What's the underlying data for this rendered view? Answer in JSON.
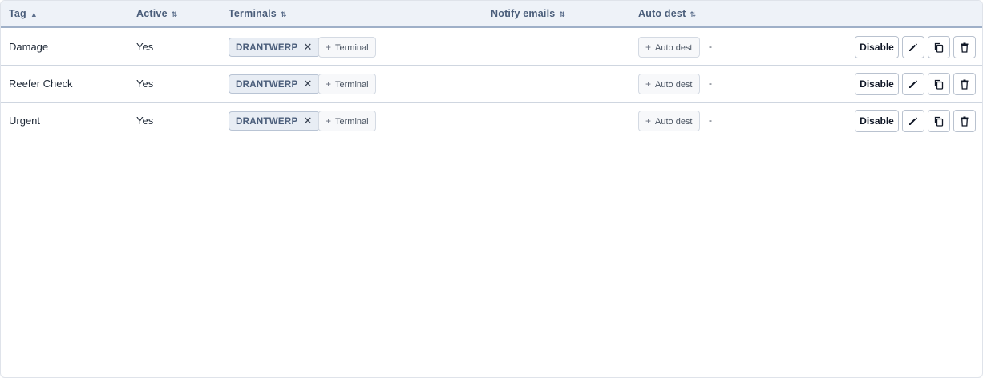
{
  "table": {
    "columns": [
      {
        "label": "Tag",
        "sort": "▲"
      },
      {
        "label": "Active",
        "sort": "⇅"
      },
      {
        "label": "Terminals",
        "sort": "⇅"
      },
      {
        "label": "Notify emails",
        "sort": "⇅"
      },
      {
        "label": "Auto dest",
        "sort": "⇅"
      }
    ],
    "rows": [
      {
        "tag": "Damage",
        "active": "Yes",
        "terminal_chip": "DRANTWERP",
        "add_terminal": "Terminal",
        "add_autodest": "Auto dest",
        "autodest_value": "-",
        "disable_label": "Disable"
      },
      {
        "tag": "Reefer Check",
        "active": "Yes",
        "terminal_chip": "DRANTWERP",
        "add_terminal": "Terminal",
        "add_autodest": "Auto dest",
        "autodest_value": "-",
        "disable_label": "Disable"
      },
      {
        "tag": "Urgent",
        "active": "Yes",
        "terminal_chip": "DRANTWERP",
        "add_terminal": "Terminal",
        "add_autodest": "Auto dest",
        "autodest_value": "-",
        "disable_label": "Disable"
      }
    ]
  },
  "icons": {
    "sort_asc": "sort-ascending-icon",
    "sort_both": "sort-icon",
    "chip_remove": "close-icon",
    "add": "plus-icon",
    "edit": "pencil-icon",
    "duplicate": "copy-icon",
    "delete": "trash-icon"
  },
  "colors": {
    "header_bg": "#eef2f8",
    "header_text": "#4a5d7a",
    "chip_bg": "#e8edf4",
    "border": "#cfd6e0"
  }
}
